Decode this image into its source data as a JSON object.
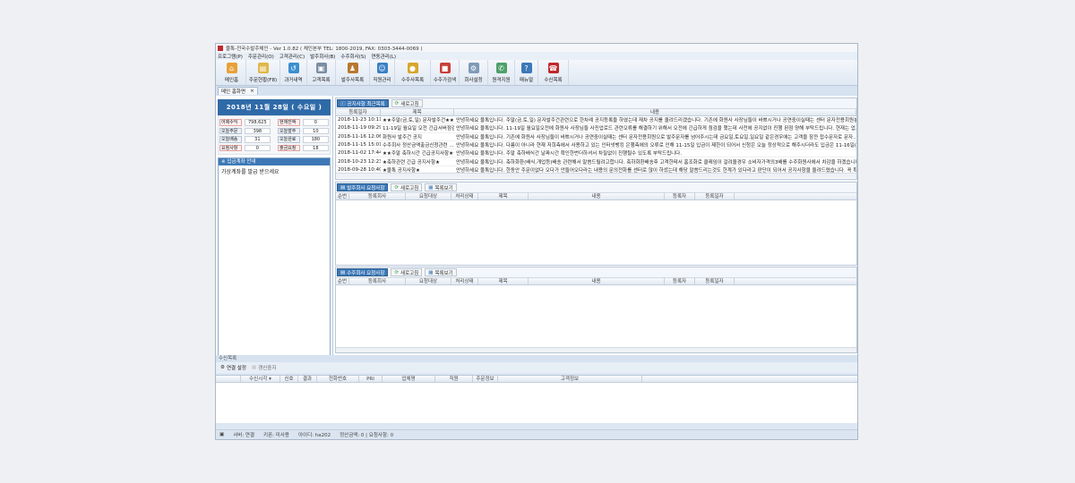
{
  "window": {
    "title": "물톡-전국수발주체인 - Ver 1.0.82 ( 체인본부 TEL: 1800-2019, FAX: 0303-3444-0069 )",
    "app_icon_text": "물톡"
  },
  "menu": [
    "프로그램(P)",
    "주문관리(O)",
    "고객관리(C)",
    "발주회사(B)",
    "수주회사(S)",
    "연동관리(L)"
  ],
  "toolbar": [
    {
      "label": "메인홈",
      "icon": "home-icon",
      "color": "#e8a13a"
    },
    {
      "label": "주문현황(F8)",
      "icon": "clipboard-icon",
      "color": "#e0b84a"
    },
    {
      "label": "과거내역",
      "icon": "history-icon",
      "color": "#3c8fd1"
    },
    {
      "label": "고객목록",
      "icon": "contact-card-icon",
      "color": "#7d8ea3"
    },
    {
      "label": "발주사목록",
      "icon": "worker-icon",
      "color": "#b8782e"
    },
    {
      "label": "직원관리",
      "icon": "staff-icon",
      "color": "#3a7fc4"
    },
    {
      "label": "수주사목록",
      "icon": "coins-icon",
      "color": "#d9a52c"
    },
    {
      "label": "수주가검색",
      "icon": "price-search-icon",
      "color": "#c9403a"
    },
    {
      "label": "회사설정",
      "icon": "settings-icon",
      "color": "#7f9ab8"
    },
    {
      "label": "원격지원",
      "icon": "remote-support-icon",
      "color": "#4ea06a"
    },
    {
      "label": "매뉴얼",
      "icon": "manual-icon",
      "color": "#3d78b6"
    },
    {
      "label": "수신목록",
      "icon": "telephone-icon",
      "color": "#c0282d"
    }
  ],
  "tab": {
    "label": "메인 홈화면",
    "close": "×"
  },
  "left": {
    "date": "2018년 11월 28일 ( 수요일 )",
    "stats": [
      [
        {
          "label": "어제수익",
          "value": "798,625",
          "alert": true
        },
        {
          "label": "현재잔액",
          "value": "0",
          "alert": true
        }
      ],
      [
        {
          "label": "오늘주문",
          "value": "398"
        },
        {
          "label": "오늘발주",
          "value": "10"
        }
      ],
      [
        {
          "label": "오늘배송",
          "value": "31"
        },
        {
          "label": "오늘완료",
          "value": "180"
        }
      ],
      [
        {
          "label": "요청사항",
          "value": "0",
          "alert": true
        },
        {
          "label": "출금요청",
          "value": "18",
          "alert": true
        }
      ]
    ],
    "info_title": "※ 입금계좌 안내",
    "info_text": "가상계좌를 발급 받으세요"
  },
  "notice": {
    "button": "공지사항 최근목록",
    "refresh": "새로고침",
    "columns": [
      "등록일자",
      "제목",
      "내용"
    ],
    "rows": [
      [
        "2018-11-23 10:11",
        "★★주말(금,토,일) 문자발주건★★",
        "안녕하세요 물톡입니다. 주말(금,토,일) 문자발주건관련으로 한차례 공지등록을 하였는데 재차 공지를 올려드리겠습니다. 기존에 화원사 사장님들이 바쁘시거나 공연중이실때는 센터 문자전용회원분..."
      ],
      [
        "2018-11-19 09:29",
        "11-19일 월요일 오전 긴급서버점검",
        "안녕하세요 물톡입니다. 11-19일 월요일오전에 화원사 사장님들 사진업로드 관련오류를 해결하기 위해서 오전에 긴급하게 점검을 했는데 사전에 공지없이 진행 된점 양해 부탁드립니다. 현재는 업그레이드..."
      ],
      [
        "2018-11-16 12:06",
        "화원사 발주건 공지",
        "안녕하세요 물톡입니다. 기존에 화원사 사장님들이 바쁘시거나 공연중이실때는 센터 문자전용회원으로 발주문자를 넘어주시는데 금요일,토요일,일요일 같은경우에는 고객을 잠깐 접수문자로 문자..."
      ],
      [
        "2018-11-15 15:01",
        "수주회사 정산금액출금신청관련 ...",
        "안녕하세요 물톡입니다. 다름이 아니라 현재 저희측에서 사용하고 있는 인터넷뱅킹 은행측에의 오류로 인해 11-15일 입금이 제한이 되어서 신청은 오늘 정상적으로 해주시더라도 입금은 11-16일(금요일)..."
      ],
      [
        "2018-11-02 17:44",
        "★★주말 축하시간 긴급공지사항★★",
        "안녕하세요 물톡입니다. 주말 축하배식간 날짜시간 확인한번더하셔서 차질없이 진행될수 있도록 부탁드립니다."
      ],
      [
        "2018-10-23 12:23",
        "★축하관련 긴급 공지사항★",
        "안녕하세요 물톡입니다. 축하화환(배식,개업등)배송 관련해서 말씀드릴려고합니다. 축하화환배송후 고객한테서 홈조화로 클레임이 걸려올경우 소비자가격의3배를 수주화원사에서 차감을 하겠습니다."
      ],
      [
        "2018-09-28 10:40",
        "★물톡 공지사항★",
        "안녕하세요 물톡입니다. 한동안 주문이없다 오다가 안들어오다라는 내용의 문의전화를 센터로 많이 하셨는데 해당 말씀드리는것도 한계가 있다라고 판단이 되어서 공지사항을 올려드렸습니다. 꼭 확인..."
      ]
    ]
  },
  "order_requests": {
    "button": "발주회사 요청사항",
    "refresh": "새로고침",
    "list": "목록보기",
    "columns": [
      "순번",
      "등록회사",
      "요청대상",
      "처리상태",
      "제목",
      "내용",
      "등록자",
      "등록일자"
    ]
  },
  "supply_requests": {
    "button": "수주회사 요청사항",
    "refresh": "새로고침",
    "list": "목록보기",
    "columns": [
      "순번",
      "등록회사",
      "요청대상",
      "처리상태",
      "제목",
      "내용",
      "등록자",
      "등록일자"
    ]
  },
  "receive": {
    "title": "수신목록",
    "connect": "연결 설정",
    "disconnect": "갱신중지",
    "columns": [
      "",
      "수신시각 ▾",
      "신호",
      "결과",
      "전화번호",
      "PRI",
      "업체명",
      "직원",
      "주문정보",
      "고객정보"
    ]
  },
  "status": {
    "server": "서버: 연결",
    "key": "키폰: 미사용",
    "user": "아이디: ha202",
    "summary": "정산금액: 0 | 요청사항: 0"
  }
}
